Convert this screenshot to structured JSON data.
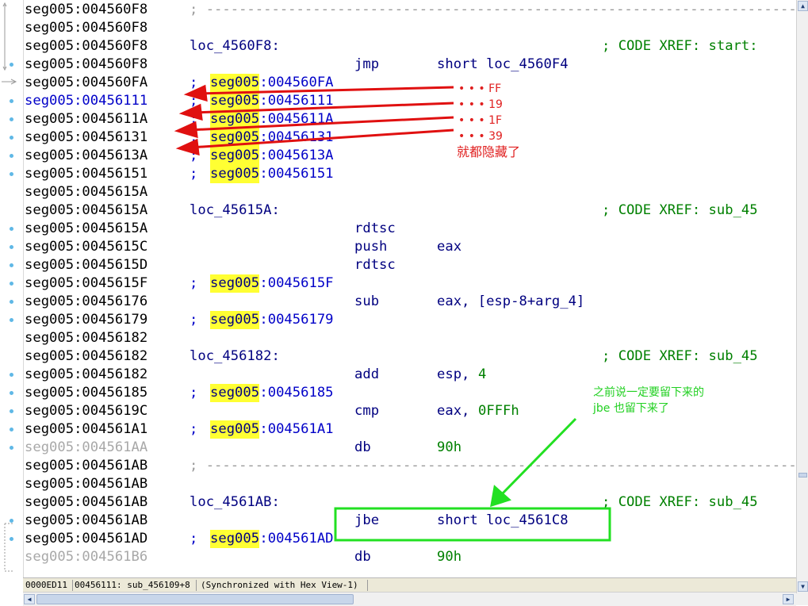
{
  "listing": [
    {
      "addr": "seg005:004560F8",
      "addr_style": "black",
      "kind": "separator",
      "text": "; ------------------------------------------------------------------------"
    },
    {
      "addr": "seg005:004560F8",
      "addr_style": "black",
      "kind": "blank"
    },
    {
      "addr": "seg005:004560F8",
      "addr_style": "black",
      "kind": "label",
      "label": "loc_4560F8:",
      "xref": "; CODE XREF: start:"
    },
    {
      "addr": "seg005:004560F8",
      "addr_style": "black",
      "kind": "instr",
      "mnemonic": "jmp",
      "operand": "short loc_4560F4"
    },
    {
      "addr": "seg005:004560FA",
      "addr_style": "black",
      "kind": "ref",
      "semi": ";",
      "seg": "seg005",
      "offset": ":004560FA"
    },
    {
      "addr": "seg005:00456111",
      "addr_style": "blue",
      "kind": "ref",
      "semi": ";",
      "seg": "seg005",
      "offset": ":00456111"
    },
    {
      "addr": "seg005:0045611A",
      "addr_style": "black",
      "kind": "ref",
      "semi": ";",
      "seg": "seg005",
      "offset": ":0045611A"
    },
    {
      "addr": "seg005:00456131",
      "addr_style": "black",
      "kind": "ref",
      "semi": ";",
      "seg": "seg005",
      "offset": ":00456131"
    },
    {
      "addr": "seg005:0045613A",
      "addr_style": "black",
      "kind": "ref",
      "semi": ";",
      "seg": "seg005",
      "offset": ":0045613A"
    },
    {
      "addr": "seg005:00456151",
      "addr_style": "black",
      "kind": "ref",
      "semi": ";",
      "seg": "seg005",
      "offset": ":00456151"
    },
    {
      "addr": "seg005:0045615A",
      "addr_style": "black",
      "kind": "blank"
    },
    {
      "addr": "seg005:0045615A",
      "addr_style": "black",
      "kind": "label",
      "label": "loc_45615A:",
      "xref": "; CODE XREF: sub_45"
    },
    {
      "addr": "seg005:0045615A",
      "addr_style": "black",
      "kind": "instr",
      "mnemonic": "rdtsc",
      "operand": ""
    },
    {
      "addr": "seg005:0045615C",
      "addr_style": "black",
      "kind": "instr",
      "mnemonic": "push",
      "operand": "eax"
    },
    {
      "addr": "seg005:0045615D",
      "addr_style": "black",
      "kind": "instr",
      "mnemonic": "rdtsc",
      "operand": ""
    },
    {
      "addr": "seg005:0045615F",
      "addr_style": "black",
      "kind": "ref",
      "semi": ";",
      "seg": "seg005",
      "offset": ":0045615F"
    },
    {
      "addr": "seg005:00456176",
      "addr_style": "black",
      "kind": "instr",
      "mnemonic": "sub",
      "operand": "eax, [esp-8+arg_4]"
    },
    {
      "addr": "seg005:00456179",
      "addr_style": "black",
      "kind": "ref",
      "semi": ";",
      "seg": "seg005",
      "offset": ":00456179"
    },
    {
      "addr": "seg005:00456182",
      "addr_style": "black",
      "kind": "blank"
    },
    {
      "addr": "seg005:00456182",
      "addr_style": "black",
      "kind": "label",
      "label": "loc_456182:",
      "xref": "; CODE XREF: sub_45"
    },
    {
      "addr": "seg005:00456182",
      "addr_style": "black",
      "kind": "instr",
      "mnemonic": "add",
      "operand": "esp, ",
      "operand_num": "4"
    },
    {
      "addr": "seg005:00456185",
      "addr_style": "black",
      "kind": "ref",
      "semi": ";",
      "seg": "seg005",
      "offset": ":00456185"
    },
    {
      "addr": "seg005:0045619C",
      "addr_style": "black",
      "kind": "instr",
      "mnemonic": "cmp",
      "operand": "eax, ",
      "operand_num": "0FFFh"
    },
    {
      "addr": "seg005:004561A1",
      "addr_style": "black",
      "kind": "ref",
      "semi": ";",
      "seg": "seg005",
      "offset": ":004561A1"
    },
    {
      "addr": "seg005:004561AA",
      "addr_style": "gray",
      "kind": "instr",
      "mnemonic": "db",
      "operand": "",
      "operand_num": "90h"
    },
    {
      "addr": "seg005:004561AB",
      "addr_style": "black",
      "kind": "separator",
      "text": "; ------------------------------------------------------------------------"
    },
    {
      "addr": "seg005:004561AB",
      "addr_style": "black",
      "kind": "blank"
    },
    {
      "addr": "seg005:004561AB",
      "addr_style": "black",
      "kind": "label",
      "label": "loc_4561AB:",
      "xref": "; CODE XREF: sub_45"
    },
    {
      "addr": "seg005:004561AB",
      "addr_style": "black",
      "kind": "instr",
      "mnemonic": "jbe",
      "operand": "short loc_4561C8"
    },
    {
      "addr": "seg005:004561AD",
      "addr_style": "black",
      "kind": "ref",
      "semi": ";",
      "seg": "seg005",
      "offset": ":004561AD"
    },
    {
      "addr": "seg005:004561B6",
      "addr_style": "gray",
      "kind": "instr",
      "mnemonic": "db",
      "operand": "",
      "operand_num": "90h"
    }
  ],
  "gutter_dot_rows": [
    3,
    5,
    6,
    7,
    8,
    9,
    12,
    13,
    14,
    15,
    16,
    17,
    20,
    21,
    22,
    23,
    24,
    28,
    29
  ],
  "status": {
    "offset": "0000ED11",
    "location": "00456111: sub_456109+8",
    "sync": "(Synchronized with Hex View-1)"
  },
  "annotations": {
    "red_bytes": [
      "• • • FF",
      "• • • 19",
      "• • • 1F",
      "• • • 39"
    ],
    "red_note": "就都隐藏了",
    "green_note_line1": "之前说一定要留下来的",
    "green_note_line2": "jbe 也留下来了"
  },
  "colors": {
    "highlight": "#ffff33",
    "address_blue": "#0000c8",
    "xref_green": "#008000",
    "annotation_red": "#e02020",
    "annotation_green": "#22d022"
  },
  "icons": {
    "scroll_up": "▲",
    "scroll_down": "▼",
    "scroll_left": "◀",
    "scroll_right": "▶"
  }
}
